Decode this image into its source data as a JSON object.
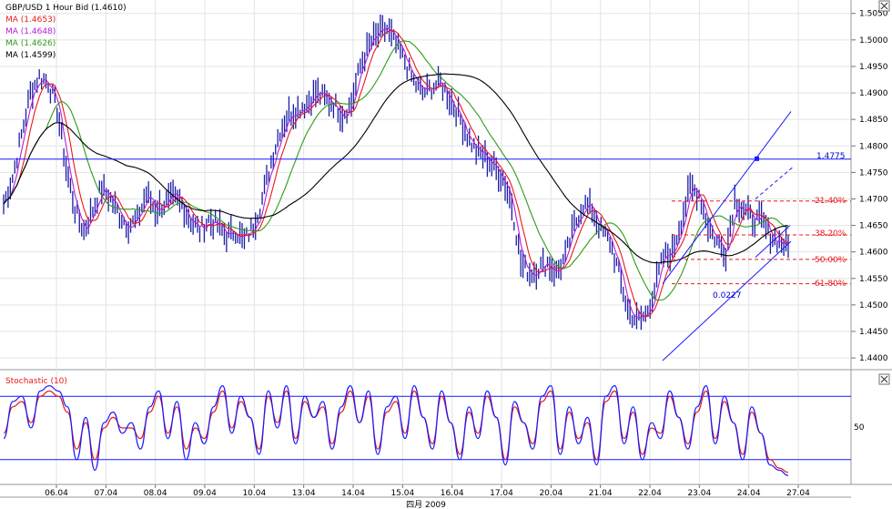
{
  "chart_data": {
    "type": "line",
    "title": "GBP/USD 1 Hour Bid (1.4610)",
    "legend": [
      {
        "label": "MA (1.4653)",
        "color": "#e8191c"
      },
      {
        "label": "MA (1.4648)",
        "color": "#b41fd8"
      },
      {
        "label": "MA (1.4626)",
        "color": "#2f9a1b"
      },
      {
        "label": "MA (1.4599)",
        "color": "#000000"
      }
    ],
    "price_ticks": [
      "1.5050",
      "1.5000",
      "1.4950",
      "1.4900",
      "1.4850",
      "1.4800",
      "1.4750",
      "1.4700",
      "1.4650",
      "1.4600",
      "1.4550",
      "1.4500",
      "1.4450",
      "1.4400"
    ],
    "price_range": [
      1.4395,
      1.5065
    ],
    "date_labels": [
      "06.04",
      "07.04",
      "08.04",
      "09.04",
      "10.04",
      "13.04",
      "14.04",
      "15.04",
      "16.04",
      "17.04",
      "20.04",
      "21.04",
      "22.04",
      "23.04",
      "24.04",
      "27.04"
    ],
    "month_label": "四月 2009",
    "hline": {
      "value": 1.4775,
      "label": "1.4775"
    },
    "fib_levels": [
      {
        "label": "21.40%",
        "value": 1.4696
      },
      {
        "label": "38.20%",
        "value": 1.4632
      },
      {
        "label": "50.00%",
        "value": 1.4586
      },
      {
        "label": "61.80%",
        "value": 1.454
      }
    ],
    "channel_label": "0.0227",
    "close_series": [
      1.469,
      1.474,
      1.482,
      1.49,
      1.493,
      1.492,
      1.487,
      1.476,
      1.468,
      1.464,
      1.468,
      1.472,
      1.47,
      1.467,
      1.465,
      1.466,
      1.471,
      1.468,
      1.469,
      1.47,
      1.469,
      1.466,
      1.464,
      1.466,
      1.465,
      1.463,
      1.464,
      1.462,
      1.465,
      1.47,
      1.477,
      1.483,
      1.486,
      1.487,
      1.488,
      1.49,
      1.489,
      1.488,
      1.486,
      1.488,
      1.495,
      1.499,
      1.501,
      1.502,
      1.499,
      1.496,
      1.492,
      1.49,
      1.491,
      1.492,
      1.489,
      1.486,
      1.482,
      1.479,
      1.478,
      1.476,
      1.474,
      1.469,
      1.458,
      1.456,
      1.457,
      1.458,
      1.456,
      1.459,
      1.465,
      1.469,
      1.468,
      1.464,
      1.462,
      1.456,
      1.449,
      1.447,
      1.448,
      1.453,
      1.459,
      1.46,
      1.466,
      1.472,
      1.471,
      1.465,
      1.462,
      1.46,
      1.47,
      1.468,
      1.466,
      1.466,
      1.463,
      1.462,
      1.461
    ],
    "stochastic": {
      "label": "Stochastic (10)",
      "level_label": "50",
      "upper": 80,
      "lower": 20,
      "k": [
        40,
        75,
        80,
        50,
        85,
        90,
        85,
        70,
        20,
        60,
        10,
        55,
        65,
        45,
        55,
        30,
        70,
        85,
        40,
        75,
        20,
        55,
        35,
        70,
        90,
        45,
        80,
        60,
        25,
        85,
        50,
        90,
        35,
        80,
        60,
        75,
        30,
        70,
        90,
        55,
        85,
        25,
        70,
        80,
        40,
        90,
        60,
        30,
        85,
        55,
        20,
        70,
        40,
        85,
        60,
        15,
        75,
        55,
        30,
        80,
        90,
        25,
        70,
        35,
        60,
        15,
        80,
        90,
        35,
        70,
        20,
        55,
        40,
        85,
        60,
        30,
        70,
        90,
        35,
        80,
        55,
        20,
        70,
        45,
        15,
        10,
        5
      ],
      "d": [
        45,
        70,
        75,
        55,
        80,
        85,
        80,
        65,
        30,
        55,
        20,
        50,
        60,
        50,
        50,
        40,
        65,
        80,
        45,
        70,
        30,
        50,
        40,
        65,
        85,
        50,
        75,
        60,
        30,
        80,
        55,
        85,
        40,
        75,
        60,
        70,
        35,
        65,
        85,
        55,
        80,
        30,
        65,
        75,
        45,
        85,
        60,
        35,
        80,
        55,
        25,
        65,
        45,
        80,
        60,
        20,
        70,
        55,
        35,
        75,
        85,
        30,
        65,
        40,
        55,
        20,
        75,
        85,
        40,
        65,
        25,
        50,
        45,
        80,
        60,
        35,
        65,
        85,
        40,
        75,
        55,
        25,
        65,
        45,
        20,
        12,
        8
      ]
    }
  }
}
